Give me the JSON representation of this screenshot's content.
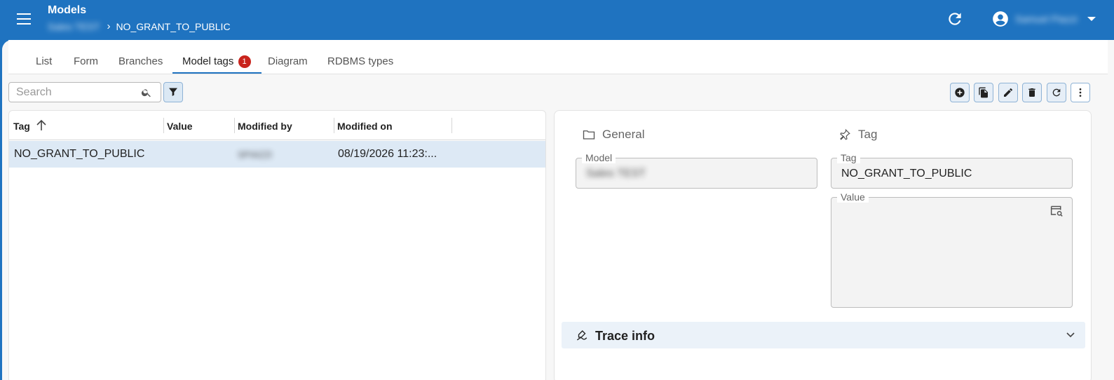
{
  "header": {
    "app_title": "Models",
    "breadcrumb_parent": "Sales TEST",
    "breadcrumb_current": "NO_GRANT_TO_PUBLIC",
    "user_name": "Samuel Piazzi"
  },
  "tabs": [
    {
      "label": "List"
    },
    {
      "label": "Form"
    },
    {
      "label": "Branches"
    },
    {
      "label": "Model tags",
      "badge": "1",
      "active": true
    },
    {
      "label": "Diagram"
    },
    {
      "label": "RDBMS types"
    }
  ],
  "search": {
    "placeholder": "Search",
    "value": ""
  },
  "grid": {
    "columns": [
      "Tag",
      "Value",
      "Modified by",
      "Modified on"
    ],
    "rows": [
      {
        "tag": "NO_GRANT_TO_PUBLIC",
        "value": "",
        "modified_by": "SPIAZZI",
        "modified_on": "08/19/2026 11:23:..."
      }
    ]
  },
  "detail": {
    "general_title": "General",
    "tag_title": "Tag",
    "model_label": "Model",
    "model_value": "Sales TEST",
    "tag_label": "Tag",
    "tag_value": "NO_GRANT_TO_PUBLIC",
    "value_label": "Value",
    "value_value": "",
    "trace_title": "Trace info"
  },
  "colors": {
    "primary": "#1f73c0",
    "badge": "#c9241d",
    "selected_row": "#dde9f5"
  }
}
